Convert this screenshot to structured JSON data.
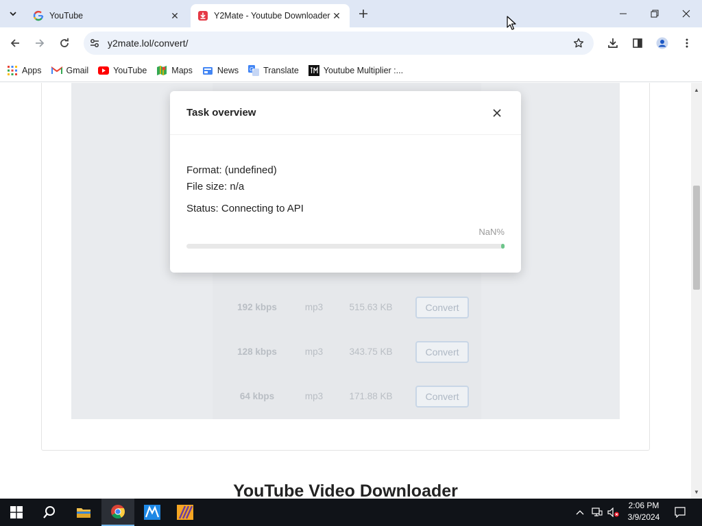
{
  "tabs": [
    {
      "title": "YouTube",
      "favicon": "google-g-icon"
    },
    {
      "title": "Y2Mate - Youtube Downloader",
      "favicon": "y2mate-download-icon"
    }
  ],
  "toolbar": {
    "url": "y2mate.lol/convert/"
  },
  "bookmarks": [
    {
      "label": "Apps",
      "icon": "apps-grid-icon"
    },
    {
      "label": "Gmail",
      "icon": "gmail-icon"
    },
    {
      "label": "YouTube",
      "icon": "youtube-icon"
    },
    {
      "label": "Maps",
      "icon": "maps-icon"
    },
    {
      "label": "News",
      "icon": "news-icon"
    },
    {
      "label": "Translate",
      "icon": "translate-icon"
    },
    {
      "label": "Youtube Multiplier :...",
      "icon": "ytm-icon"
    }
  ],
  "page": {
    "rows": [
      {
        "quality": "192 kbps",
        "format": "mp3",
        "size": "515.63 KB",
        "button": "Convert"
      },
      {
        "quality": "128 kbps",
        "format": "mp3",
        "size": "343.75 KB",
        "button": "Convert"
      },
      {
        "quality": "64 kbps",
        "format": "mp3",
        "size": "171.88 KB",
        "button": "Convert"
      }
    ],
    "heading": "YouTube Video Downloader"
  },
  "modal": {
    "title": "Task overview",
    "format": "Format: (undefined)",
    "file_size": "File size: n/a",
    "status": "Status: Connecting to API",
    "percent": "NaN%",
    "progress_fill_fraction": 0.01
  },
  "taskbar": {
    "time": "2:06 PM",
    "date": "3/9/2024"
  },
  "colors": {
    "tab_strip": "#dfe7f5",
    "omnibox": "#edf2fa",
    "overlay": "#e9ebee",
    "progress_fill": "#6dc58a",
    "taskbar": "#101318"
  }
}
